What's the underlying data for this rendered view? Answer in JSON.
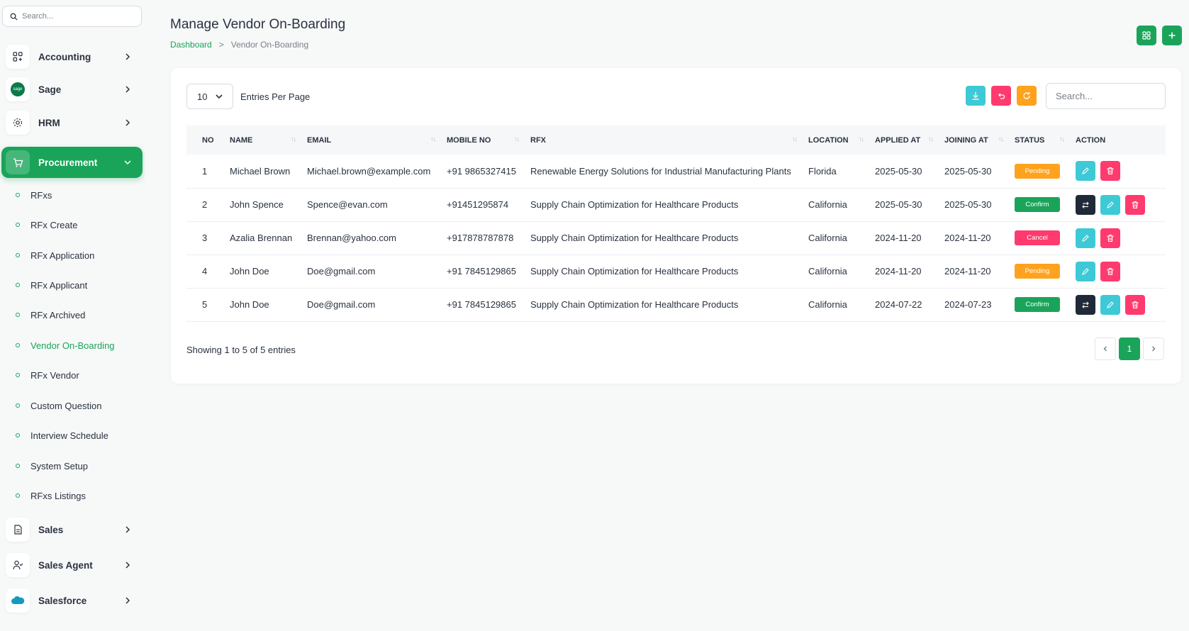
{
  "sidebar": {
    "search_placeholder": "Search...",
    "main_items": [
      {
        "label": "Accounting",
        "icon": "grid-apps-icon"
      },
      {
        "label": "Sage",
        "icon": "sage-logo-icon"
      },
      {
        "label": "HRM",
        "icon": "hrm-icon"
      },
      {
        "label": "Procurement",
        "icon": "cart-icon"
      },
      {
        "label": "Sales",
        "icon": "document-icon"
      },
      {
        "label": "Sales Agent",
        "icon": "user-check-icon"
      },
      {
        "label": "Salesforce",
        "icon": "salesforce-cloud-icon"
      }
    ],
    "sage_logo_text": "sage",
    "sub_items": [
      "RFxs",
      "RFx Create",
      "RFx Application",
      "RFx Applicant",
      "RFx Archived",
      "Vendor On-Boarding",
      "RFx Vendor",
      "Custom Question",
      "Interview Schedule",
      "System Setup",
      "RFxs Listings"
    ],
    "active_sub": "Vendor On-Boarding"
  },
  "header": {
    "title": "Manage Vendor On-Boarding",
    "breadcrumb": {
      "home": "Dashboard",
      "separator": ">",
      "current": "Vendor On-Boarding"
    }
  },
  "toolbar": {
    "per_page_value": "10",
    "per_page_label": "Entries Per Page",
    "search_placeholder": "Search..."
  },
  "table": {
    "columns": [
      "NO",
      "NAME",
      "EMAIL",
      "MOBILE NO",
      "RFX",
      "LOCATION",
      "APPLIED AT",
      "JOINING AT",
      "STATUS",
      "ACTION"
    ],
    "rows": [
      {
        "no": "1",
        "name": "Michael Brown",
        "email": "Michael.brown@example.com",
        "mobile": "+91 9865327415",
        "rfx": "Renewable Energy Solutions for Industrial Manufacturing Plants",
        "location": "Florida",
        "applied": "2025-05-30",
        "joining": "2025-05-30",
        "status": "Pending"
      },
      {
        "no": "2",
        "name": "John Spence",
        "email": "Spence@evan.com",
        "mobile": "+91451295874",
        "rfx": "Supply Chain Optimization for Healthcare Products",
        "location": "California",
        "applied": "2025-05-30",
        "joining": "2025-05-30",
        "status": "Confirm"
      },
      {
        "no": "3",
        "name": "Azalia Brennan",
        "email": "Brennan@yahoo.com",
        "mobile": "+917878787878",
        "rfx": "Supply Chain Optimization for Healthcare Products",
        "location": "California",
        "applied": "2024-11-20",
        "joining": "2024-11-20",
        "status": "Cancel"
      },
      {
        "no": "4",
        "name": "John Doe",
        "email": "Doe@gmail.com",
        "mobile": "+91 7845129865",
        "rfx": "Supply Chain Optimization for Healthcare Products",
        "location": "California",
        "applied": "2024-11-20",
        "joining": "2024-11-20",
        "status": "Pending"
      },
      {
        "no": "5",
        "name": "John Doe",
        "email": "Doe@gmail.com",
        "mobile": "+91 7845129865",
        "rfx": "Supply Chain Optimization for Healthcare Products",
        "location": "California",
        "applied": "2024-07-22",
        "joining": "2024-07-23",
        "status": "Confirm"
      }
    ]
  },
  "footer": {
    "showing": "Showing 1 to 5 of 5 entries",
    "current_page": "1"
  },
  "colors": {
    "primary": "#1aa45a",
    "pending": "#ffa21d",
    "confirm": "#1aa45a",
    "cancel": "#ff3a6e",
    "info": "#3ec9d6",
    "danger": "#ff3a6e",
    "dark": "#1f2937"
  }
}
